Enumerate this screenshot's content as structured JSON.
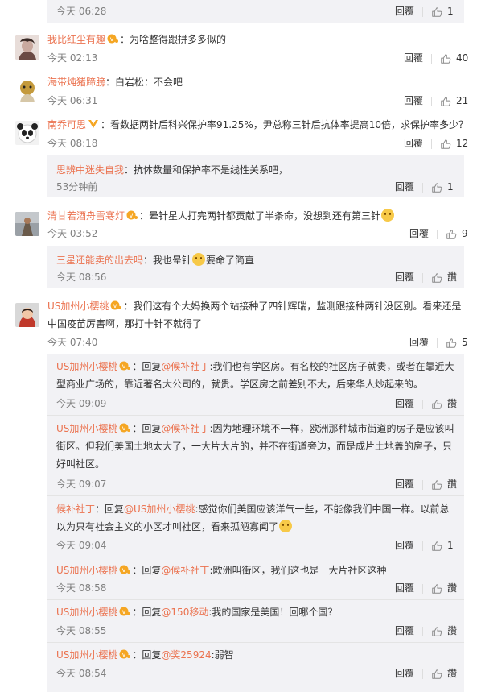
{
  "icons": {
    "thumb": "thumb-up-icon",
    "vip": "vip-badge-icon"
  },
  "colors": {
    "name": "#eb7350",
    "sub_bg": "#f2f2f5",
    "gray": "#808080"
  },
  "top": {
    "time": "今天 06:28",
    "reply": "回覆",
    "likes": "1"
  },
  "c1": {
    "name": "我比红尘有趣",
    "text": "：为啥整得跟拼多多似的",
    "time": "今天 02:13",
    "reply": "回覆",
    "likes": "40"
  },
  "c2": {
    "name": "海带炖猪蹄膀",
    "text": "：白岩松：不会吧",
    "time": "今天 06:31",
    "reply": "回覆",
    "likes": "21"
  },
  "c3": {
    "name": "南乔可思",
    "text": "：看数据两针后科兴保护率91.25%，尹总称三针后抗体率提高10倍，求保护率多少？",
    "time": "今天 08:18",
    "reply": "回覆",
    "likes": "12",
    "sub": {
      "name": "思辨中迷失自我",
      "text": "：抗体数量和保护率不是线性关系吧，",
      "time": "53分钟前",
      "reply": "回覆",
      "likes": "1"
    }
  },
  "c4": {
    "name": "清甘若酒舟雪寒灯",
    "text": "：晕针星人打完两针都贡献了半条命，没想到还有第三针",
    "time": "今天 03:52",
    "reply": "回覆",
    "likes": "9",
    "sub": {
      "name": "三星还能卖的出去吗",
      "text_a": "：我也晕针",
      "text_b": "要命了简直",
      "time": "今天 08:56",
      "reply": "回覆",
      "likes": "讚"
    }
  },
  "c5": {
    "name": "US加州小樱桃",
    "text_1": "：我们这有个大妈换两个站接种了四针辉瑞，监测跟接种两针没区别。看来还是",
    "text_2": "中国疫苗厉害啊，那打十针不就得了",
    "time": "今天 07:40",
    "reply": "回覆",
    "likes": "5",
    "replies": [
      {
        "name": "US加州小樱桃",
        "pre": "：回复",
        "at": "@候补社丁",
        "text_1": ":我们也有学区房。有名校的社区房子就贵，或者在靠近大",
        "text_2": "型商业广场的，靠近著名大公司的，就贵。学区房之前差别不大，后来华人炒起来的。",
        "time": "今天 09:09",
        "reply": "回覆",
        "likes": "讚"
      },
      {
        "name": "US加州小樱桃",
        "pre": "：回复",
        "at": "@候补社丁",
        "text_1": ":因为地理环境不一样，欧洲那种城市街道的房子是应该叫",
        "text_2": "街区。但我们美国土地太大了，一大片大片的，并不在街道旁边，而是成片土地盖的房子，只",
        "text_3": "好叫社区。",
        "time": "今天 09:07",
        "reply": "回覆",
        "likes": "讚"
      },
      {
        "name": "候补社丁",
        "pre": "：回复",
        "at": "@US加州小樱桃",
        "text_1": ":感觉你们美国应该洋气一些，不能像我们中国一样。以前总",
        "text_2": "以为只有社会主义的小区才叫社区，看来孤陋寡闻了",
        "time": "今天 09:04",
        "reply": "回覆",
        "likes": "1"
      },
      {
        "name": "US加州小樱桃",
        "pre": "：回复",
        "at": "@候补社丁",
        "text_1": ":欧洲叫街区，我们这也是一大片社区这种",
        "time": "今天 08:58",
        "reply": "回覆",
        "likes": "讚"
      },
      {
        "name": "US加州小樱桃",
        "pre": "：回复",
        "at": "@150移动",
        "text_1": ":我的国家是美国！回哪个国？",
        "time": "今天 08:55",
        "reply": "回覆",
        "likes": "讚"
      },
      {
        "name": "US加州小樱桃",
        "pre": "：回复",
        "at": "@奖25924",
        "text_1": ":弱智",
        "time": "今天 08:54",
        "reply": "回覆",
        "likes": "讚"
      }
    ]
  }
}
